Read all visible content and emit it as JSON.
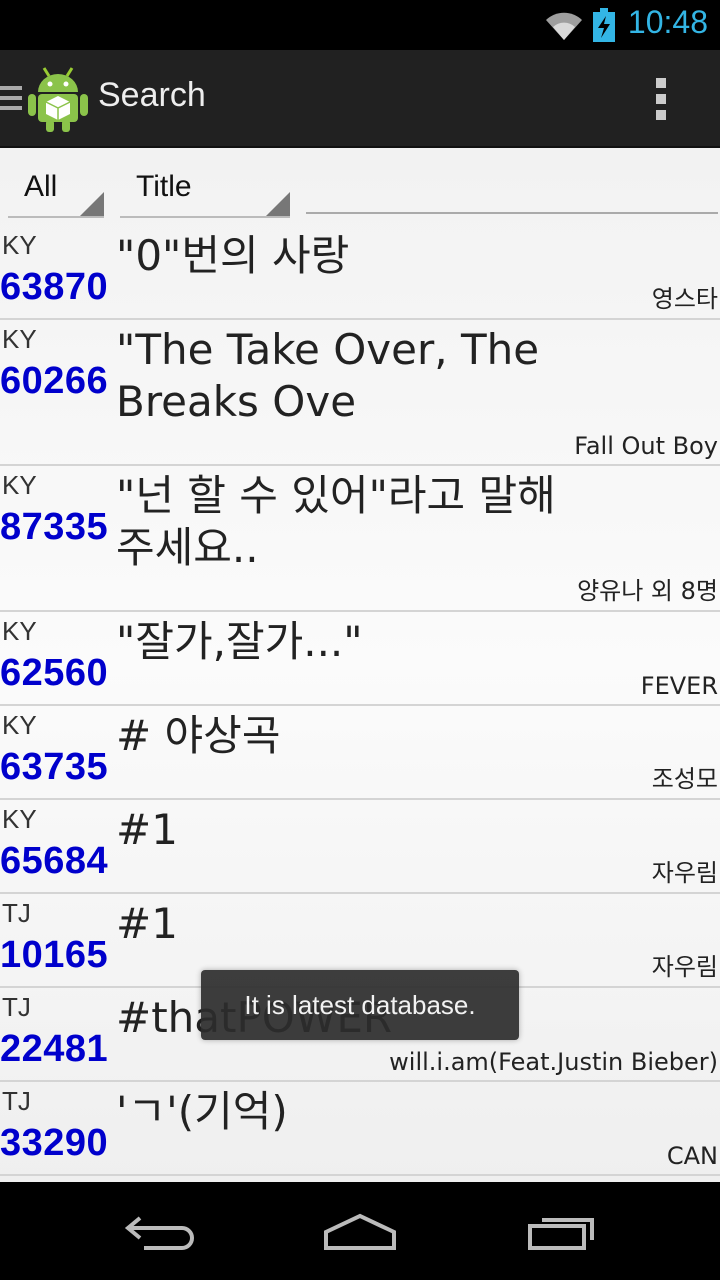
{
  "status_bar": {
    "time": "10:48",
    "icons": [
      "wifi-icon",
      "battery-charging-icon"
    ],
    "accent_color": "#33b5e5"
  },
  "action_bar": {
    "title": "Search",
    "icons": [
      "drawer-icon",
      "app-icon",
      "overflow-menu-icon"
    ]
  },
  "filters": {
    "category": "All",
    "field": "Title",
    "search_value": ""
  },
  "results": [
    {
      "brand": "KY",
      "number": "63870",
      "title": "\"0\"번의 사랑",
      "artist": "영스타"
    },
    {
      "brand": "KY",
      "number": "60266",
      "title": "\"The Take Over, The Breaks Ove",
      "artist": "Fall Out Boy"
    },
    {
      "brand": "KY",
      "number": "87335",
      "title": "\"넌 할 수 있어\"라고 말해 주세요..",
      "artist": "양유나 외 8명"
    },
    {
      "brand": "KY",
      "number": "62560",
      "title": "\"잘가,잘가...\"",
      "artist": "FEVER"
    },
    {
      "brand": "KY",
      "number": "63735",
      "title": "# 야상곡",
      "artist": "조성모"
    },
    {
      "brand": "KY",
      "number": "65684",
      "title": "#1",
      "artist": "자우림"
    },
    {
      "brand": "TJ",
      "number": "10165",
      "title": "#1",
      "artist": "자우림"
    },
    {
      "brand": "TJ",
      "number": "22481",
      "title": "#thatPOWER",
      "artist": "will.i.am(Feat.Justin Bieber)"
    },
    {
      "brand": "TJ",
      "number": "33290",
      "title": "'ㄱ'(기억)",
      "artist": "CAN"
    }
  ],
  "toast": "It is latest database.",
  "colors": {
    "number": "#0000cc",
    "action_bar": "#212121"
  },
  "nav_bar": {
    "buttons": [
      "back-icon",
      "home-icon",
      "recent-apps-icon"
    ]
  }
}
